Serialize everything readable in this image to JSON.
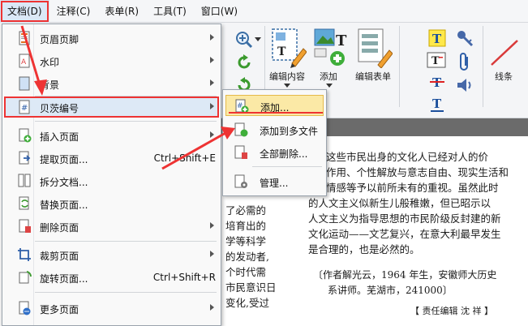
{
  "menubar": {
    "items": [
      {
        "label": "文档(D)"
      },
      {
        "label": "注释(C)"
      },
      {
        "label": "表单(R)"
      },
      {
        "label": "工具(T)"
      },
      {
        "label": "窗口(W)"
      }
    ]
  },
  "toolbar": {
    "edit_content": "编辑内容",
    "add": "添加",
    "edit_form": "编辑表单",
    "lines": "线条"
  },
  "doc_menu": {
    "items": [
      {
        "label": "页眉页脚"
      },
      {
        "label": "水印"
      },
      {
        "label": "背景"
      },
      {
        "label": "贝茨编号"
      },
      {
        "label": "插入页面"
      },
      {
        "label": "提取页面...",
        "shortcut": "Ctrl+Shift+E"
      },
      {
        "label": "拆分文档..."
      },
      {
        "label": "替换页面..."
      },
      {
        "label": "删除页面"
      },
      {
        "label": "裁剪页面"
      },
      {
        "label": "旋转页面...",
        "shortcut": "Ctrl+Shift+R"
      },
      {
        "label": "更多页面"
      }
    ]
  },
  "bates_submenu": {
    "items": [
      {
        "label": "添加..."
      },
      {
        "label": "添加到多文件"
      },
      {
        "label": "全部删除..."
      },
      {
        "label": "管理..."
      }
    ]
  },
  "document": {
    "right_lines": [
      "这些市民出身的文化人已经对人的价",
      "作用、个性解放与意志自由、现实生活和",
      "情感等予以前所未有的重视。虽然此时",
      "的人文主义似新生儿般稚嫩，但已昭示以",
      "人文主义为指导思想的市民阶级反封建的新",
      "文化运动——文艺复兴，在意大利最早发生",
      "是合理的，也是必然的。"
    ],
    "author_lines": [
      "〔作者解光云，1964 年生，安徽师大历史",
      "系讲师。芜湖市，241000〕"
    ],
    "editor_line": "【 责任编辑  沈  祥 】",
    "left_lines": [
      "了必需的",
      "培育出的",
      "学等科学",
      "的发动者,",
      "个时代需",
      "市民意识日",
      "变化,受过"
    ]
  },
  "colors": {
    "highlight_red": "#e33333",
    "menu_selected": "#dde9f6",
    "submenu_selected": "#fbe9a6"
  }
}
